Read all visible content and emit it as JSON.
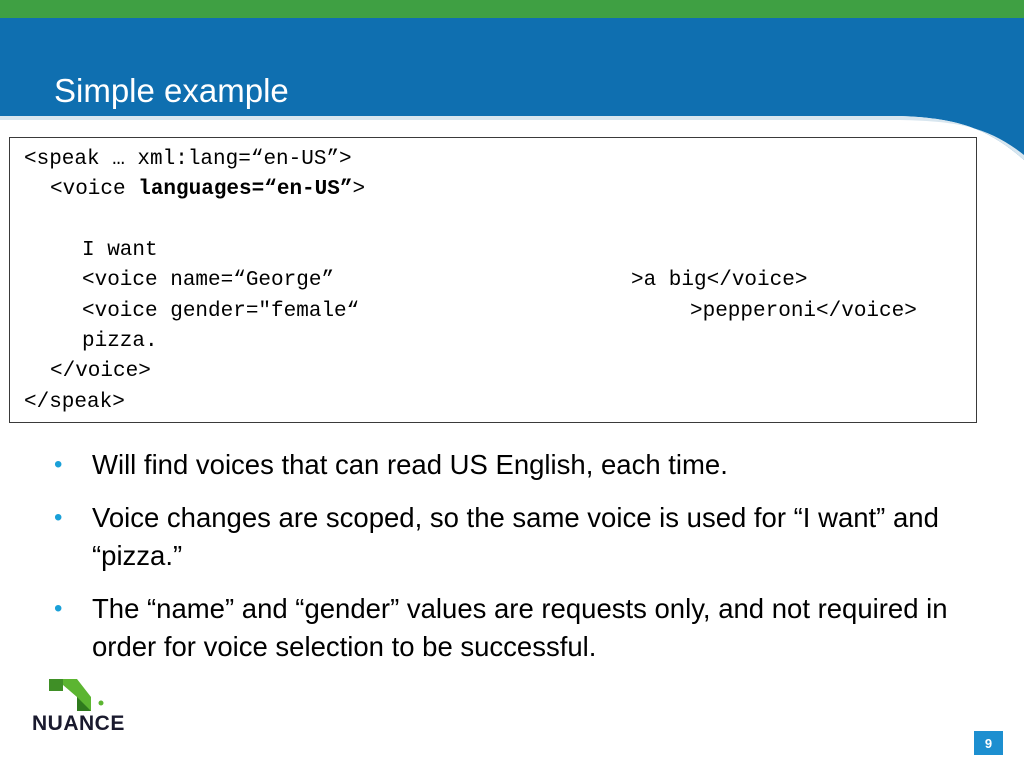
{
  "slide": {
    "title": "Simple example",
    "page_number": "9",
    "colors": {
      "header_blue": "#0f6fb0",
      "header_green": "#3fa043",
      "bullet_blue": "#1aa0d8"
    }
  },
  "code": {
    "line1": "<speak … xml:lang=“en-US”>",
    "line2_pre": "<voice ",
    "line2_bold": "languages=“en-US”",
    "line2_post": ">",
    "line4": "I want",
    "line5_a": "<voice name=“George”",
    "line5_b": ">a big</voice>",
    "line6_a": "<voice gender=\"female“",
    "line6_b": ">pepperoni</voice>",
    "line7": "pizza.",
    "line8": "</voice>",
    "line9": "</speak>"
  },
  "bullets": [
    {
      "text": "Will find voices that can read US English, each time."
    },
    {
      "text": "Voice changes are scoped, so the same voice is used for “I want” and “pizza.”"
    },
    {
      "text": "The “name” and “gender” values are requests only, and not required in order for voice selection to be successful."
    }
  ],
  "logo": {
    "text": "NUANCE",
    "icon": "nuance-logo-icon"
  }
}
